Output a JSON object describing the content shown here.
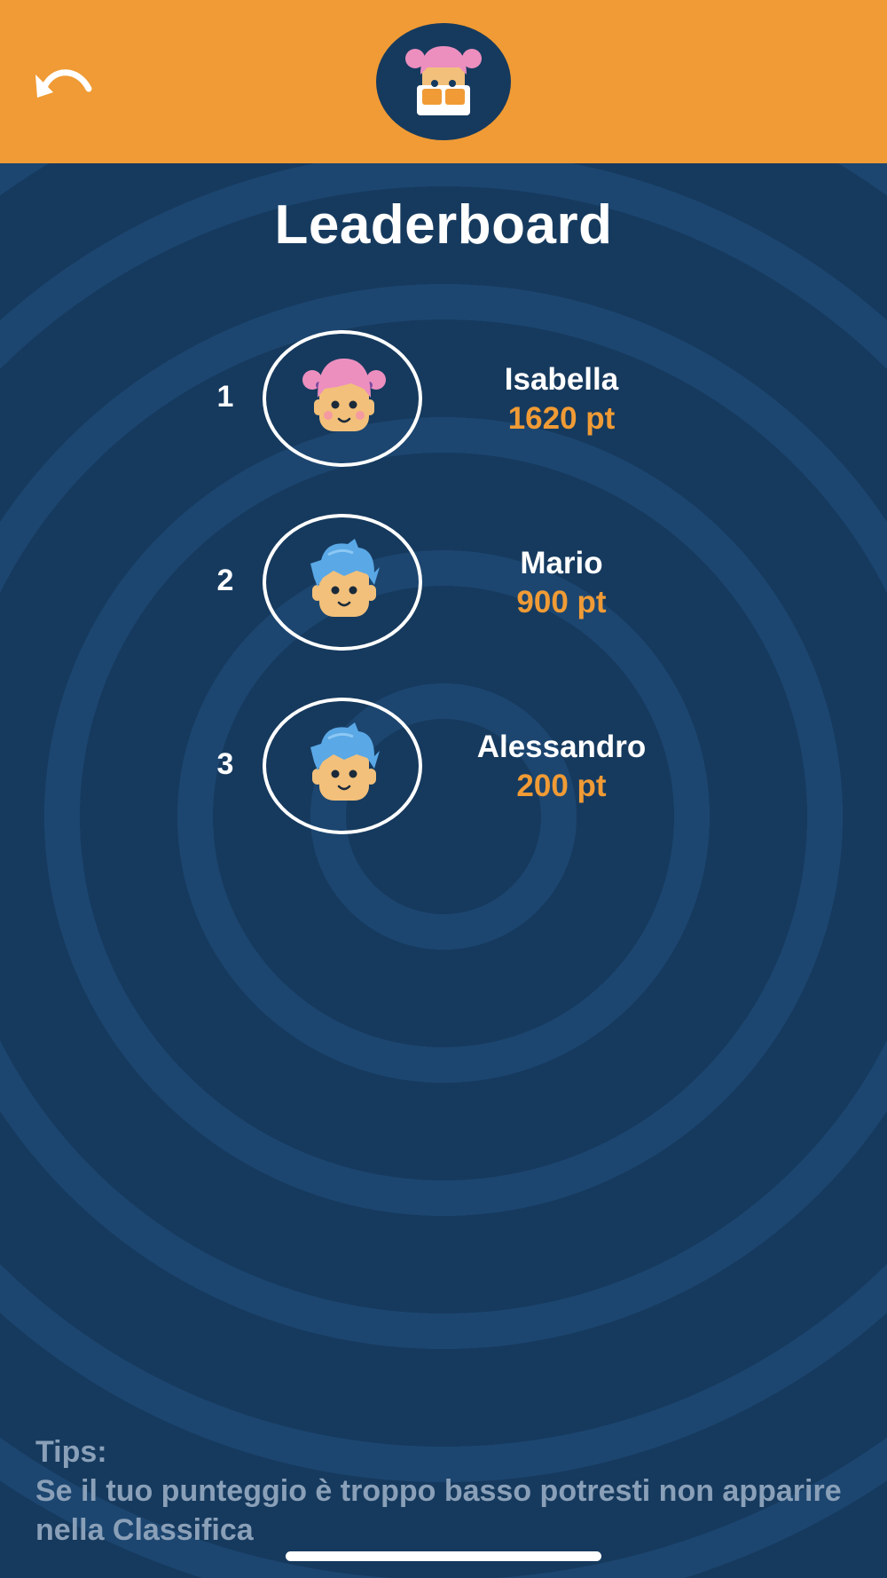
{
  "header": {
    "back_icon": "undo-arrow-icon",
    "avatar_icon": "girl-avatar-with-glasses-icon"
  },
  "title": "Leaderboard",
  "leaderboard": [
    {
      "rank": "1",
      "name": "Isabella",
      "score": "1620 pt",
      "avatar_icon": "girl-pink-hair-avatar"
    },
    {
      "rank": "2",
      "name": "Mario",
      "score": "900 pt",
      "avatar_icon": "boy-blue-hair-avatar"
    },
    {
      "rank": "3",
      "name": "Alessandro",
      "score": "200 pt",
      "avatar_icon": "boy-blue-hair-avatar"
    }
  ],
  "tips": {
    "label": "Tips:",
    "text": "Se il tuo punteggio è troppo basso potresti non apparire nella Classifica"
  },
  "colors": {
    "header": "#f09b35",
    "background": "#163a5e",
    "score": "#f09b35"
  }
}
